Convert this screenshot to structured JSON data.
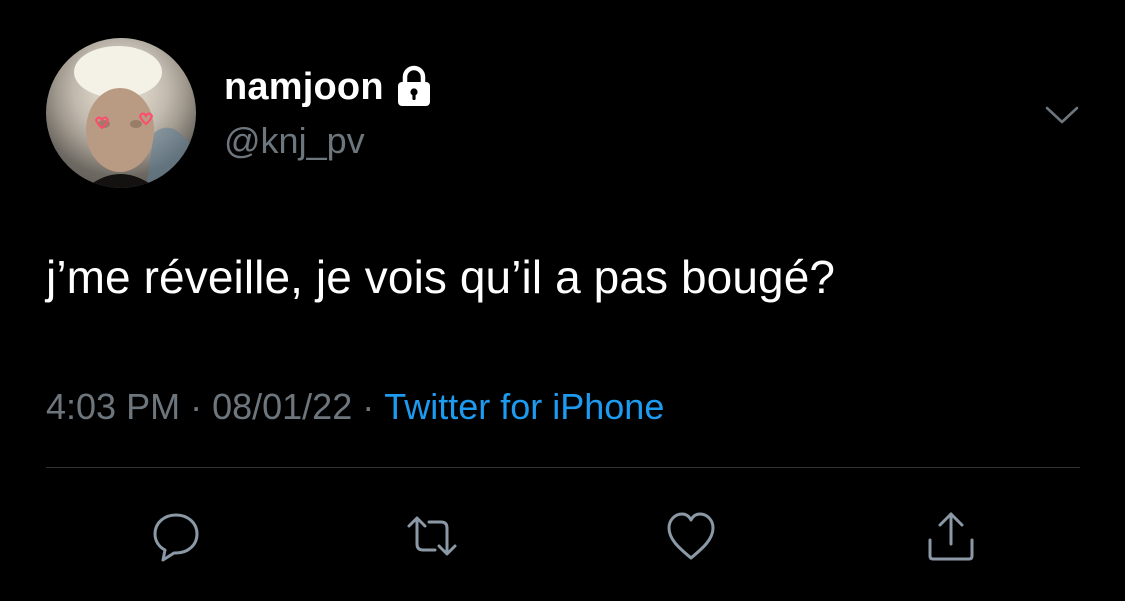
{
  "user": {
    "display_name": "namjoon",
    "handle": "@knj_pv",
    "protected": true
  },
  "tweet": {
    "text": "j’me réveille, je vois qu’il a pas bougé?"
  },
  "meta": {
    "time": "4:03 PM",
    "separator": "·",
    "date": "08/01/22",
    "source": "Twitter for iPhone"
  },
  "colors": {
    "background": "#000000",
    "primary_text": "#ffffff",
    "secondary_text": "#6e767d",
    "link": "#1d9bf0",
    "divider": "#2f3336"
  },
  "icons": {
    "more": "chevron-down-icon",
    "lock": "lock-icon",
    "reply": "reply-icon",
    "retweet": "retweet-icon",
    "like": "heart-icon",
    "share": "share-icon"
  }
}
